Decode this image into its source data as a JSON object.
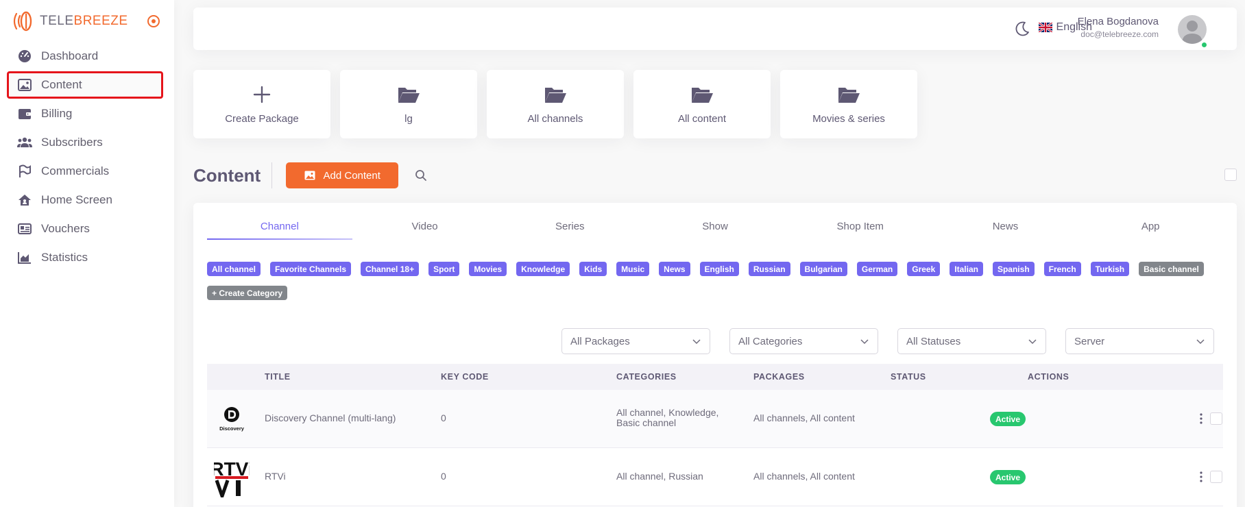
{
  "brand": {
    "name_prefix": "TELE",
    "name_accent": "BREEZE",
    "accent_color": "#f26a2e"
  },
  "sidebar": {
    "items": [
      {
        "label": "Dashboard",
        "icon": "dashboard-icon"
      },
      {
        "label": "Content",
        "icon": "image-icon",
        "active": true
      },
      {
        "label": "Billing",
        "icon": "wallet-icon"
      },
      {
        "label": "Subscribers",
        "icon": "users-icon"
      },
      {
        "label": "Commercials",
        "icon": "flag-icon"
      },
      {
        "label": "Home Screen",
        "icon": "home-icon"
      },
      {
        "label": "Vouchers",
        "icon": "voucher-icon"
      },
      {
        "label": "Statistics",
        "icon": "chart-icon"
      }
    ]
  },
  "header": {
    "language": "English",
    "user_name": "Elena Bogdanova",
    "user_email": "doc@telebreeze.com"
  },
  "packages": [
    {
      "label": "Create Package",
      "icon": "plus-icon"
    },
    {
      "label": "lg",
      "icon": "folder-open-icon"
    },
    {
      "label": "All channels",
      "icon": "folder-open-icon"
    },
    {
      "label": "All content",
      "icon": "folder-open-icon"
    },
    {
      "label": "Movies & series",
      "icon": "folder-open-icon"
    }
  ],
  "content": {
    "title": "Content",
    "add_button": "Add Content"
  },
  "tabs": [
    "Channel",
    "Video",
    "Series",
    "Show",
    "Shop Item",
    "News",
    "App"
  ],
  "active_tab": "Channel",
  "categories": [
    "All channel",
    "Favorite Channels",
    "Channel 18+",
    "Sport",
    "Movies",
    "Knowledge",
    "Kids",
    "Music",
    "News",
    "English",
    "Russian",
    "Bulgarian",
    "German",
    "Greek",
    "Italian",
    "Spanish",
    "French",
    "Turkish",
    "Basic channel"
  ],
  "create_category": "+ Create Category",
  "filters": [
    "All Packages",
    "All Categories",
    "All Statuses",
    "Server"
  ],
  "table": {
    "columns": [
      "TITLE",
      "KEY CODE",
      "CATEGORIES",
      "PACKAGES",
      "STATUS",
      "ACTIONS"
    ],
    "rows": [
      {
        "logo": "Discovery",
        "title": "Discovery Channel (multi-lang)",
        "key_code": "0",
        "categories": "All channel, Knowledge, Basic channel",
        "packages": "All channels, All content",
        "status": "Active"
      },
      {
        "logo": "RTVi",
        "title": "RTVi",
        "key_code": "0",
        "categories": "All channel, Russian",
        "packages": "All channels, All content",
        "status": "Active"
      }
    ]
  },
  "colors": {
    "primary": "#7367f0",
    "orange": "#f26a2e",
    "success": "#28c76f",
    "highlight": "#e5141b"
  }
}
